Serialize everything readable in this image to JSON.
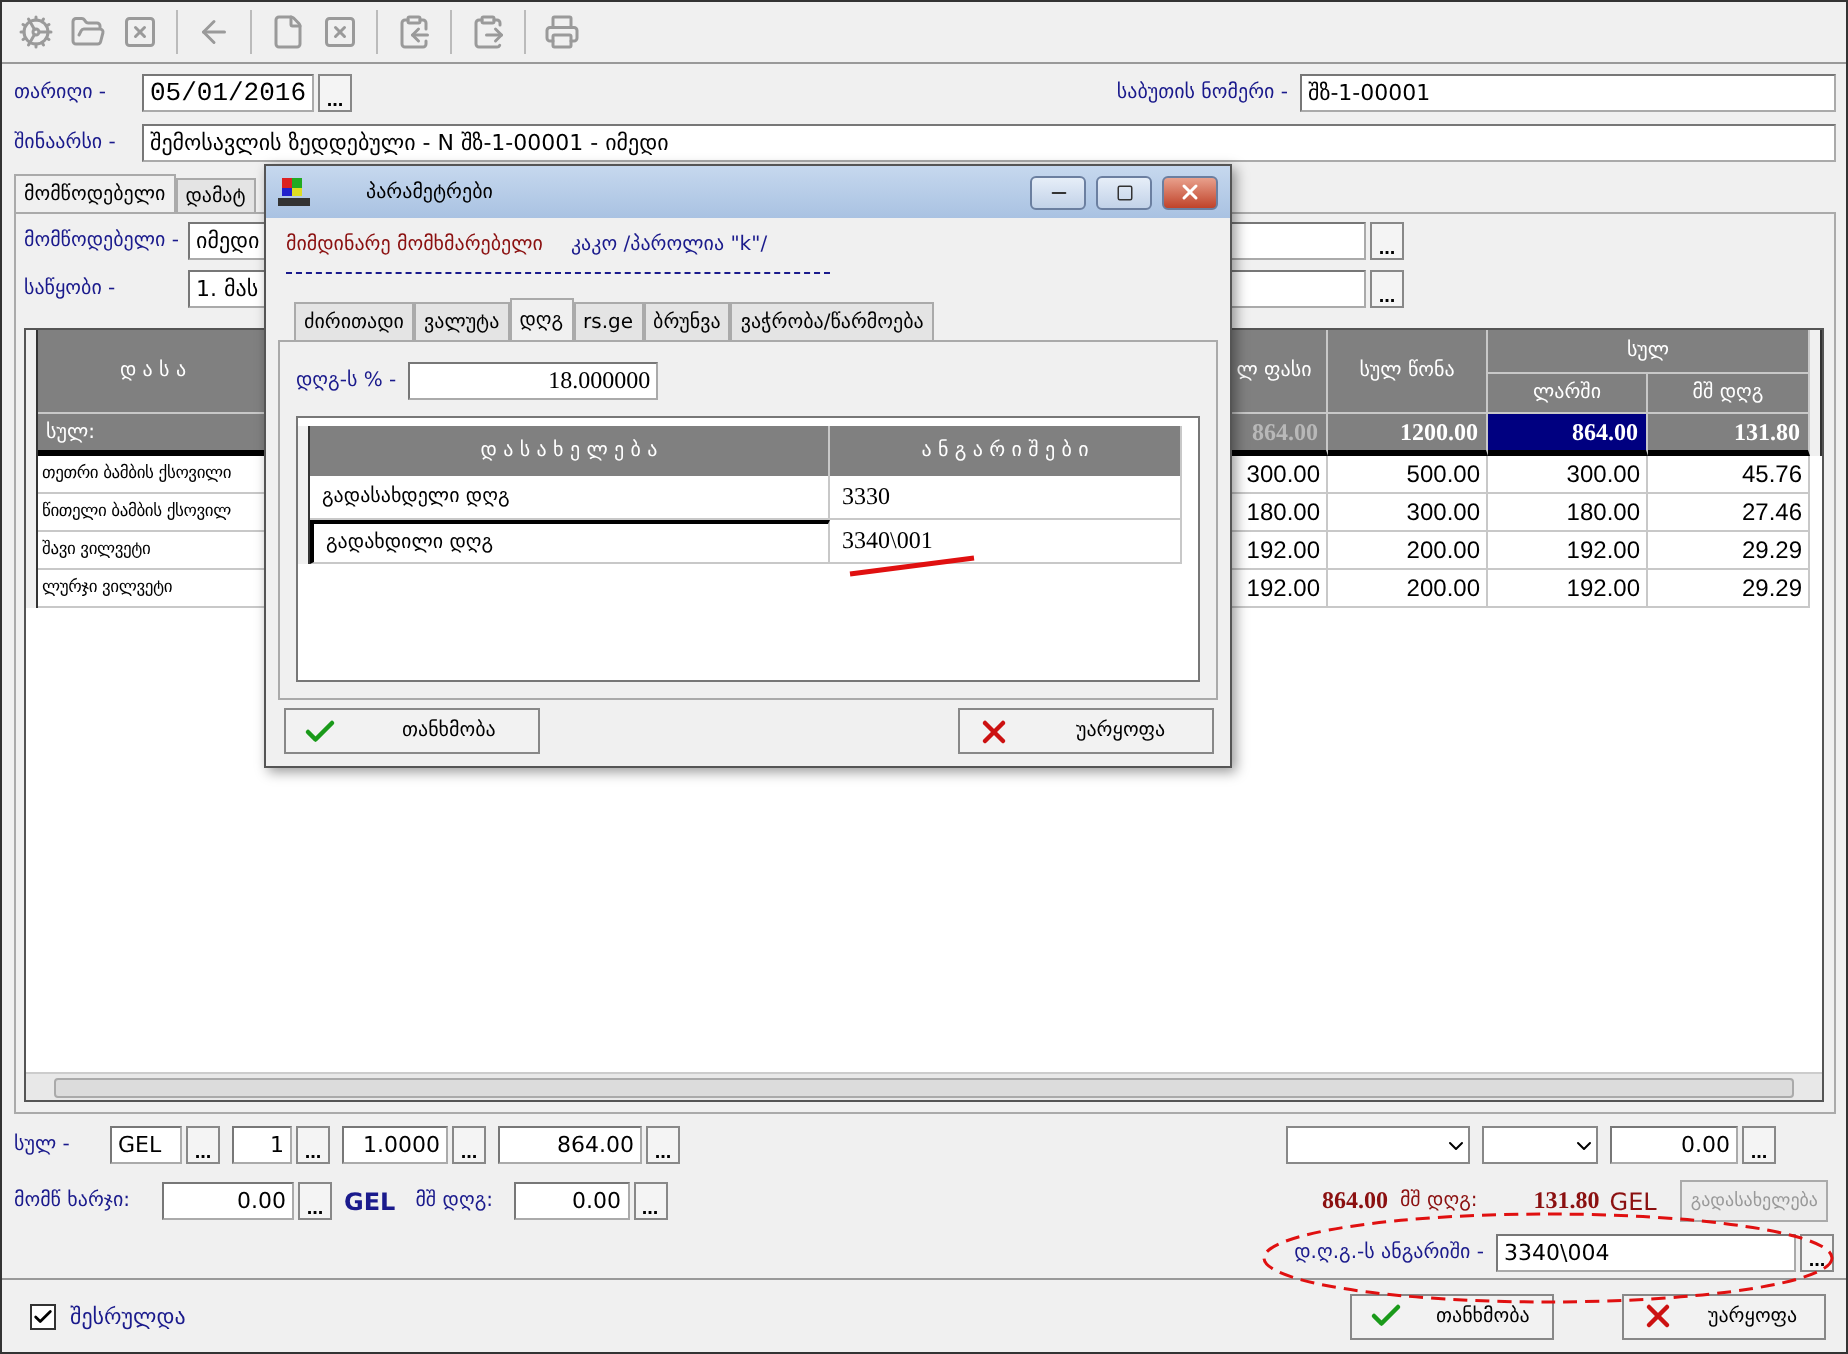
{
  "form": {
    "date_label": "თარიღი -",
    "date": "05/01/2016",
    "date_picker": "...",
    "doc_number_label": "საბუთის ნომერი -",
    "doc_number": "შზ-1-00001",
    "content_label": "შინაარსი -",
    "content": "შემოსავლის ზედდებული - N შზ-1-00001 - იმედი"
  },
  "tabs": [
    {
      "label": "მომწოდებელი",
      "selected": true
    },
    {
      "label": "დამატ",
      "selected": false
    }
  ],
  "supplier": {
    "label": "მომწოდებელი -",
    "value": "იმედი",
    "picker": "..."
  },
  "warehouse": {
    "label": "საწყობი -",
    "value": "1. მას",
    "picker": "..."
  },
  "grid": {
    "name_header": "დ ა ს ა",
    "columns": [
      "ლ ფასი",
      "სულ წონა"
    ],
    "group_header": "სულ",
    "group_columns": [
      "ლარში",
      "მშ დღგ"
    ],
    "total_label": "სულ:",
    "totals": [
      {
        "text": "864.00",
        "dim": true,
        "selected": false
      },
      {
        "text": "1200.00",
        "dim": false,
        "selected": false
      },
      {
        "text": "864.00",
        "dim": false,
        "selected": true
      },
      {
        "text": "131.80",
        "dim": false,
        "selected": false
      }
    ],
    "rows": [
      {
        "name": "თეთრი ბამბის ქსოვილი",
        "values": [
          "300.00",
          "500.00",
          "300.00",
          "45.76"
        ]
      },
      {
        "name": "წითელი ბამბის ქსოვილ",
        "values": [
          "180.00",
          "300.00",
          "180.00",
          "27.46"
        ]
      },
      {
        "name": "შავი ვილვეტი",
        "values": [
          "192.00",
          "200.00",
          "192.00",
          "29.29"
        ]
      },
      {
        "name": "ლურჯი ვილვეტი",
        "values": [
          "192.00",
          "200.00",
          "192.00",
          "29.29"
        ]
      }
    ]
  },
  "summary": {
    "label": "სულ -",
    "currency": "GEL",
    "currency_picker": "...",
    "count": "1",
    "count_picker": "...",
    "rate": "1.0000",
    "rate_picker": "...",
    "amount": "864.00",
    "amount_picker": "...",
    "right_value": "0.00",
    "right_picker": "..."
  },
  "expenses": {
    "label": "მომწ ხარჯი:",
    "value": "0.00",
    "value_picker": "...",
    "currency": "GEL",
    "vat_label": "მშ დღგ:",
    "vat_value": "0.00",
    "vat_picker": "...",
    "total": "864.00",
    "total_vat_label": "მშ დღგ:",
    "total_vat": "131.80",
    "total_currency": "GEL",
    "action": {
      "label": "გადასახელება",
      "disabled": true
    }
  },
  "vat_account": {
    "label": "დ.ღ.გ.-ს ანგარიში -",
    "value": "3340\\004",
    "picker": "..."
  },
  "completed": {
    "label": "შესრულდა",
    "checked": true
  },
  "buttons": [
    {
      "label": "თანხმობა",
      "kind": "ok"
    },
    {
      "label": "უარყოფა",
      "kind": "cancel"
    }
  ],
  "dialog": {
    "title": "პარამეტრები",
    "user_label": "მიმდინარე მომხმარებელი",
    "user": "კაკო /პაროლია \"k\"/",
    "tabs": [
      {
        "label": "ძირითადი",
        "selected": false
      },
      {
        "label": "ვალუტა",
        "selected": false
      },
      {
        "label": "დღგ",
        "selected": true
      },
      {
        "label": "rs.ge",
        "selected": false
      },
      {
        "label": "ბრუნვა",
        "selected": false
      },
      {
        "label": "ვაჭრობა/წარმოება",
        "selected": false
      }
    ],
    "vat_label": "დღგ-ს % -",
    "vat_value": "18.000000",
    "columns": [
      "დ ა ს ა ხ ე ლ ე ბ ა",
      "ა ნ გ ა რ ი შ ე ბ ი"
    ],
    "rows": [
      {
        "name": "გადასახდელი დღგ",
        "account": "3330",
        "selected": false
      },
      {
        "name": "გადახდილი დღგ",
        "account": "3340\\001",
        "selected": true
      }
    ],
    "buttons": [
      {
        "label": "თანხმობა",
        "kind": "ok"
      },
      {
        "label": "უარყოფა",
        "kind": "cancel"
      }
    ]
  }
}
